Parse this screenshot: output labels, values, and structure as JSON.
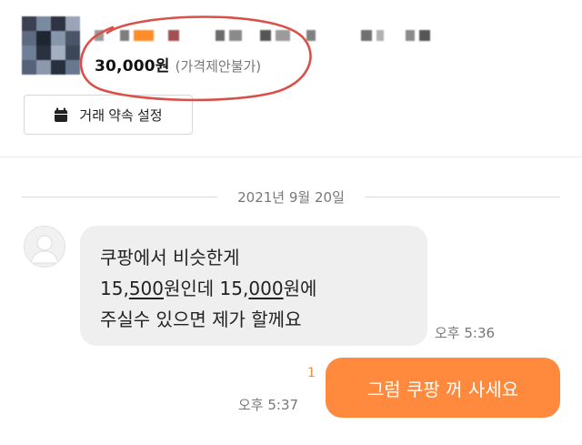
{
  "item": {
    "thumbnail_colors": [
      "#3b4150",
      "#7a8aa0",
      "#2e3444",
      "#9aa6b8",
      "#5d6b80",
      "#1f2633",
      "#8796ab",
      "#4a5568",
      "#6e7f96",
      "#2a3140",
      "#a4b0c2",
      "#3d4759",
      "#55627a",
      "#8c99ad",
      "#27303f",
      "#687891"
    ],
    "seller_blur_colors": [
      "#9a9a9a",
      "#ffffff",
      "#7d7d7d",
      "#ff8c2a",
      "#ffffff",
      "#a05050",
      "#ffffff",
      "#6c6c6c",
      "#8a8a8a",
      "#ffffff",
      "#555555",
      "#9a9a9a",
      "#ffffff",
      "#808080",
      "#ffffff",
      "#707070",
      "#b0b0b0",
      "#ffffff",
      "#8a8a8a",
      "#555555"
    ],
    "price": "30,000원",
    "price_note": "(가격제안불가)",
    "appointment_label": "거래 약속 설정"
  },
  "chat": {
    "date": "2021년 9월 20일",
    "incoming": {
      "line1": "쿠팡에서 비슷한게",
      "line2_a": "15,",
      "line2_u1": "500",
      "line2_b": "원인데 15,",
      "line2_u2": "000",
      "line2_c": "원에",
      "line3": "주실수 있으면 제가 할께요",
      "time": "오후 5:36"
    },
    "outgoing": {
      "text": "그럼 쿠팡 꺼 사세요",
      "unread_count": "1",
      "time": "오후 5:37"
    }
  },
  "colors": {
    "accent": "#ff8a3d",
    "annotation_circle": "#d9504a",
    "bubble_gray": "#efeff0"
  }
}
